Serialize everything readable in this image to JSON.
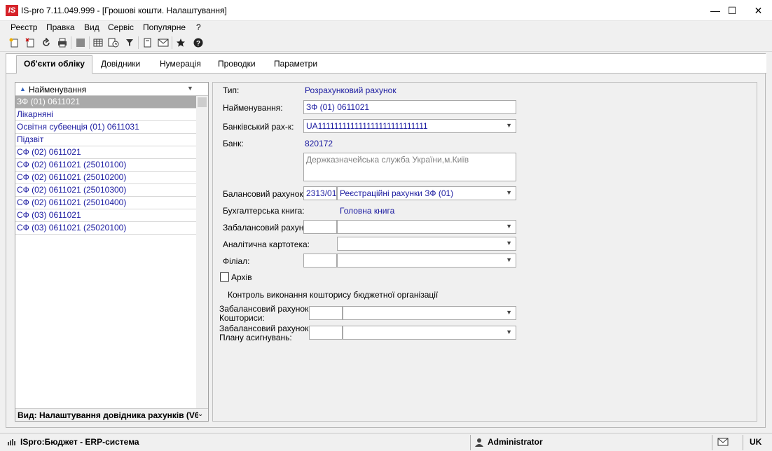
{
  "window": {
    "logo": "IS",
    "title": "IS-pro 7.11.049.999 - [Грошові кошти. Налаштування]",
    "minimize": "—",
    "maximize": "☐",
    "close": "✕"
  },
  "menu": [
    "Реєстр",
    "Правка",
    "Вид",
    "Сервіс",
    "Популярне",
    "?"
  ],
  "toolbar_icons": [
    "new-doc-icon",
    "new-copy-icon",
    "refresh-icon",
    "print-icon",
    "stop-icon",
    "table-icon",
    "history-icon",
    "filter-icon",
    "attach-icon",
    "mail-icon",
    "favorite-icon",
    "help-icon"
  ],
  "tabs": [
    "Об'єкти обліку",
    "Довідники",
    "Нумерація",
    "Проводки",
    "Параметри"
  ],
  "list": {
    "header": "Найменування",
    "rows": [
      "ЗФ (01) 0611021",
      "Лікарняні",
      "Освітня субвенція (01) 0611031",
      "Підзвіт",
      "СФ (02) 0611021",
      "СФ (02) 0611021 (25010100)",
      "СФ (02) 0611021 (25010200)",
      "СФ (02) 0611021 (25010300)",
      "СФ (02) 0611021 (25010400)",
      "СФ (03) 0611021",
      "СФ (03) 0611021 (25020100)"
    ],
    "footer": "Вид: Налаштування довідника рахунків (V6"
  },
  "form": {
    "type_label": "Тип:",
    "type_value": "Розрахунковий рахунок",
    "name_label": "Найменування:",
    "name_value": "ЗФ (01) 0611021",
    "bank_account_label": "Банківський рах-к:",
    "bank_account_value": "UA111111111111111111111111111",
    "bank_label": "Банк:",
    "bank_code": "820172",
    "bank_name": "Держказначейська служба України,м.Київ",
    "balance_label": "Балансовий рахунок:",
    "balance_code": "2313/01",
    "balance_name": "Реєстраційні рахунки ЗФ (01)",
    "book_label": "Бухгалтерська книга:",
    "book_value": "Головна книга",
    "offbalance_label": "Забалансовий рахунок:",
    "analytic_label": "Аналітична картотека:",
    "branch_label": "Філіал:",
    "archive_label": "Архів",
    "control_header": "Контроль виконання кошторису бюджетної організації",
    "ob_estimates_line1": "Забалансовий рахунок",
    "ob_estimates_line2": "Кошториси:",
    "ob_plan_line1": "Забалансовий рахунок",
    "ob_plan_line2": "Плану асигнувань:"
  },
  "status": {
    "app": "ISpro:Бюджет - ERP-система",
    "user": "Administrator",
    "lang": "UK"
  }
}
